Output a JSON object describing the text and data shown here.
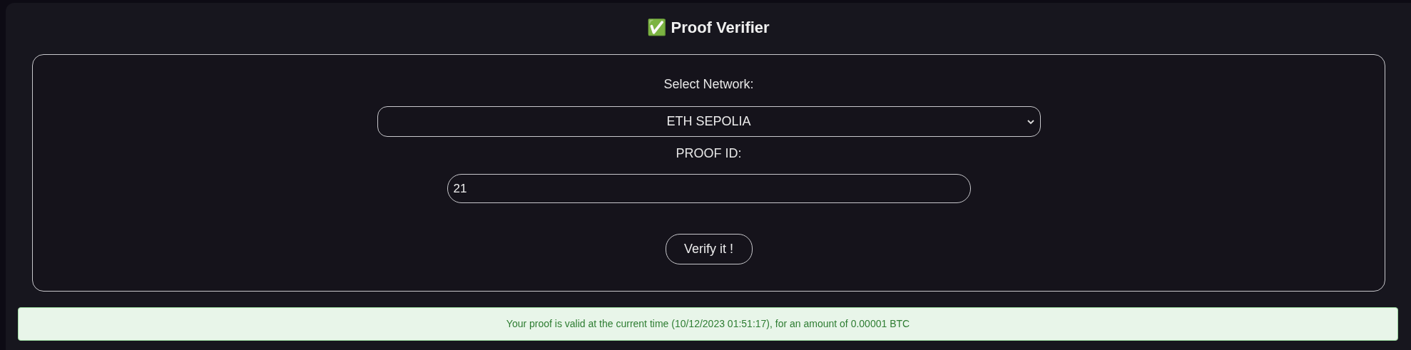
{
  "title": "✅ Proof Verifier",
  "form": {
    "network_label": "Select Network:",
    "network_value": "ETH SEPOLIA",
    "proof_label": "PROOF ID:",
    "proof_value": "21",
    "button": "Verify it !"
  },
  "alert": {
    "kind": "success",
    "message": "Your proof is valid at the current time (10/12/2023 01:51:17), for an amount of 0.00001 BTC"
  }
}
